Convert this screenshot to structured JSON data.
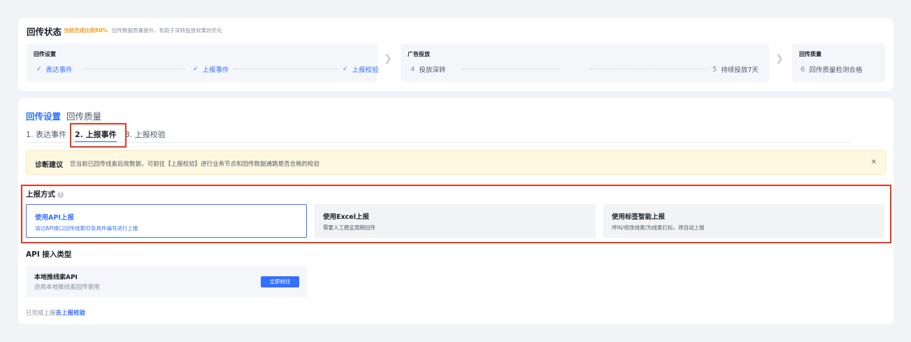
{
  "status": {
    "title": "回传状态",
    "highlight": "当前完成比例50%",
    "description": "回传数据质量提升，有助于深转投放效果的优化"
  },
  "stages": [
    {
      "title": "回传设置",
      "steps": [
        {
          "label": "表达事件",
          "done": true
        },
        {
          "label": "上报事件",
          "done": true
        },
        {
          "label": "上报校验",
          "done": true
        }
      ]
    },
    {
      "title": "广告投放",
      "steps": [
        {
          "num": "4",
          "label": "投放深转",
          "done": false
        },
        {
          "num": "5",
          "label": "持续投放7天",
          "done": false
        }
      ]
    },
    {
      "title": "回传质量",
      "steps": [
        {
          "num": "6",
          "label": "回传质量检测合格",
          "done": false
        }
      ]
    }
  ],
  "section_tabs": [
    {
      "label": "回传设置",
      "active": true
    },
    {
      "label": "回传质量",
      "active": false
    }
  ],
  "sub_tabs": [
    {
      "label": "1. 表达事件",
      "active": false
    },
    {
      "label": "2. 上报事件",
      "active": true
    },
    {
      "label": "3. 上报校验",
      "active": false
    }
  ],
  "diagnosis": {
    "title": "诊断建议",
    "text": "您当前已回传线索后效数据，可前往【上报校验】进行业务节点和回传数据通路是否合格的校验",
    "close": "×"
  },
  "report_method": {
    "title": "上报方式",
    "help_icon": "?",
    "options": [
      {
        "title": "使用API上报",
        "desc": "请过API接口回传线索ID及具件编号进行上报",
        "active": true
      },
      {
        "title": "使用Excel上报",
        "desc": "需要人工稳定周期回传",
        "active": false
      },
      {
        "title": "使用标签智能上报",
        "desc": "呼叫/修改线索/为线索打标，将自动上报",
        "active": false
      }
    ]
  },
  "api_type": {
    "title": "API 接入类型",
    "card_title": "本地推线索API",
    "card_desc": "适用本地推线索回传使用",
    "button": "立即前往"
  },
  "footer": {
    "prefix": "已完成上报",
    "link": "去上报校验"
  },
  "colors": {
    "primary": "#3370ff",
    "highlight": "#f0a020",
    "annotation": "#e8361f",
    "notice_bg": "#fff8e0"
  }
}
